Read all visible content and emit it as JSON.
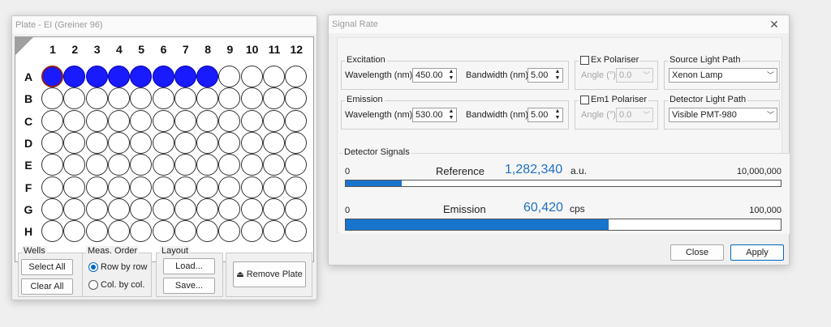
{
  "plate_window": {
    "title": "Plate - EI (Greiner 96)",
    "columns": [
      "1",
      "2",
      "3",
      "4",
      "5",
      "6",
      "7",
      "8",
      "9",
      "10",
      "11",
      "12"
    ],
    "rows": [
      "A",
      "B",
      "C",
      "D",
      "E",
      "F",
      "G",
      "H"
    ],
    "filled_wells": [
      "A1",
      "A2",
      "A3",
      "A4",
      "A5",
      "A6",
      "A7",
      "A8"
    ],
    "selected_well": "A1",
    "well_fill_color": "#1a1aff",
    "wells_group": {
      "title": "Wells",
      "select_all": "Select All",
      "clear_all": "Clear All"
    },
    "meas_order_group": {
      "title": "Meas. Order",
      "row_by_row": "Row by row",
      "col_by_col": "Col. by col.",
      "selected": "row_by_row"
    },
    "layout_group": {
      "title": "Layout",
      "load": "Load...",
      "save": "Save..."
    },
    "remove_plate": "Remove Plate",
    "remove_icon": "eject-icon"
  },
  "signal_window": {
    "title": "Signal Rate",
    "excitation": {
      "title": "Excitation",
      "wavelength_label": "Wavelength (nm):",
      "wavelength": "450.00",
      "bandwidth_label": "Bandwidth (nm):",
      "bandwidth": "5.00"
    },
    "emission": {
      "title": "Emission",
      "wavelength_label": "Wavelength (nm):",
      "wavelength": "530.00",
      "bandwidth_label": "Bandwidth (nm):",
      "bandwidth": "5.00"
    },
    "ex_polariser": {
      "label": "Ex Polariser",
      "angle_label": "Angle (°):",
      "angle": "0.0"
    },
    "em_polariser": {
      "label": "Em1 Polariser",
      "angle_label": "Angle (°):",
      "angle": "0.0"
    },
    "source_light_path": {
      "title": "Source Light Path",
      "value": "Xenon Lamp"
    },
    "detector_light_path": {
      "title": "Detector Light Path",
      "value": "Visible PMT-980"
    },
    "detector_signals": {
      "title": "Detector Signals",
      "reference": {
        "label": "Reference",
        "value": "1,282,340",
        "unit": "a.u.",
        "min": "0",
        "max": "10,000,000",
        "fraction": 0.1282
      },
      "emission": {
        "label": "Emission",
        "value": "60,420",
        "unit": "cps",
        "min": "0",
        "max": "100,000",
        "fraction": 0.6042
      }
    },
    "close_label": "Close",
    "apply_label": "Apply",
    "accent_color": "#1874cd"
  }
}
